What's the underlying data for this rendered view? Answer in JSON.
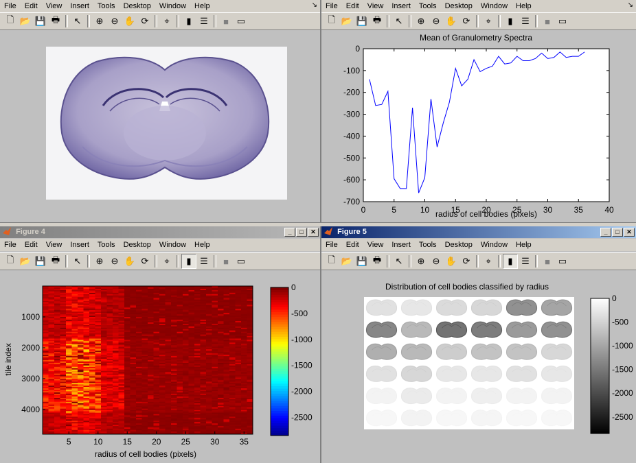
{
  "menu": [
    "File",
    "Edit",
    "View",
    "Insert",
    "Tools",
    "Desktop",
    "Window",
    "Help"
  ],
  "toolbar_icons": [
    "new-file-icon",
    "open-folder-icon",
    "save-icon",
    "print-icon",
    "pointer-icon",
    "zoom-in-icon",
    "zoom-out-icon",
    "pan-hand-icon",
    "rotate-3d-icon",
    "data-cursor-icon",
    "colorbar-icon",
    "legend-icon",
    "hide-plot-tools-icon",
    "show-plot-tools-icon"
  ],
  "windows": {
    "w1": {
      "kind": "image"
    },
    "w2": {
      "kind": "line-plot"
    },
    "w4": {
      "title": "Figure 4",
      "state": "inactive"
    },
    "w5": {
      "title": "Figure 5",
      "state": "active"
    }
  },
  "colors": {
    "plot_line": "#0000ff",
    "figure_bg": "#c0c0c0",
    "axes_bg": "#ffffff",
    "titlebar_active": "#0a246a"
  },
  "chart_data": [
    {
      "type": "line",
      "title": "Mean of Granulometry Spectra",
      "xlabel": "radius of cell bodies (pixels)",
      "ylabel": "",
      "xlim": [
        0,
        40
      ],
      "ylim": [
        -700,
        0
      ],
      "xticks": [
        0,
        5,
        10,
        15,
        20,
        25,
        30,
        35,
        40
      ],
      "yticks": [
        0,
        -100,
        -200,
        -300,
        -400,
        -500,
        -600,
        -700
      ],
      "series": [
        {
          "x": [
            1,
            2,
            3,
            4,
            5,
            6,
            7,
            8,
            9,
            10,
            11,
            12,
            13,
            14,
            15,
            16,
            17,
            18,
            19,
            20,
            21,
            22,
            23,
            24,
            25,
            26,
            27,
            28,
            29,
            30,
            31,
            32,
            33,
            34,
            35,
            36
          ],
          "values": [
            -140,
            -260,
            -255,
            -195,
            -595,
            -640,
            -640,
            -270,
            -660,
            -590,
            -230,
            -450,
            -340,
            -245,
            -90,
            -170,
            -140,
            -50,
            -105,
            -90,
            -80,
            -35,
            -70,
            -65,
            -35,
            -55,
            -55,
            -45,
            -20,
            -45,
            -40,
            -15,
            -40,
            -35,
            -35,
            -15
          ]
        }
      ]
    },
    {
      "type": "heatmap",
      "title": "",
      "xlabel": "radius of cell bodies (pixels)",
      "ylabel": "tile index",
      "xticks": [
        5,
        10,
        15,
        20,
        25,
        30,
        35
      ],
      "yticks": [
        1000,
        2000,
        3000,
        4000
      ],
      "colorbar": {
        "ticks": [
          0,
          -500,
          -1000,
          -1500,
          -2000,
          -2500
        ],
        "colormap": "jet"
      }
    },
    {
      "type": "heatmap",
      "title": "Distribution of cell bodies classified by radius",
      "grid": {
        "rows": 6,
        "cols": 6
      },
      "colorbar": {
        "ticks": [
          0,
          -500,
          -1000,
          -1500,
          -2000,
          -2500
        ],
        "colormap": "gray"
      }
    }
  ]
}
